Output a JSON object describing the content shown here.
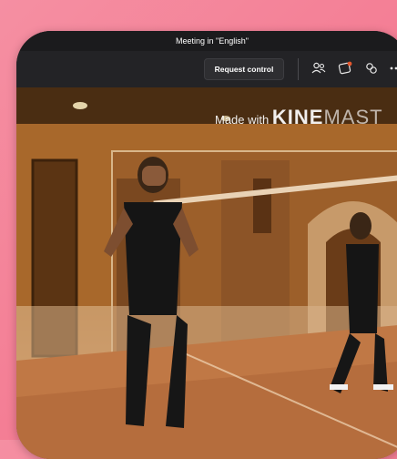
{
  "window": {
    "title": "Meeting in \"English\""
  },
  "toolbar": {
    "request_control_label": "Request control",
    "icons": [
      "people-icon",
      "share-icon",
      "reaction-icon",
      "more-icon"
    ]
  },
  "video": {
    "watermark_prefix": "Made with ",
    "watermark_brand": "KINE",
    "watermark_brand_tail": "MAST"
  },
  "colors": {
    "background": "#f47d94",
    "toolbar": "#232326",
    "accent_dot": "#e4572e"
  }
}
